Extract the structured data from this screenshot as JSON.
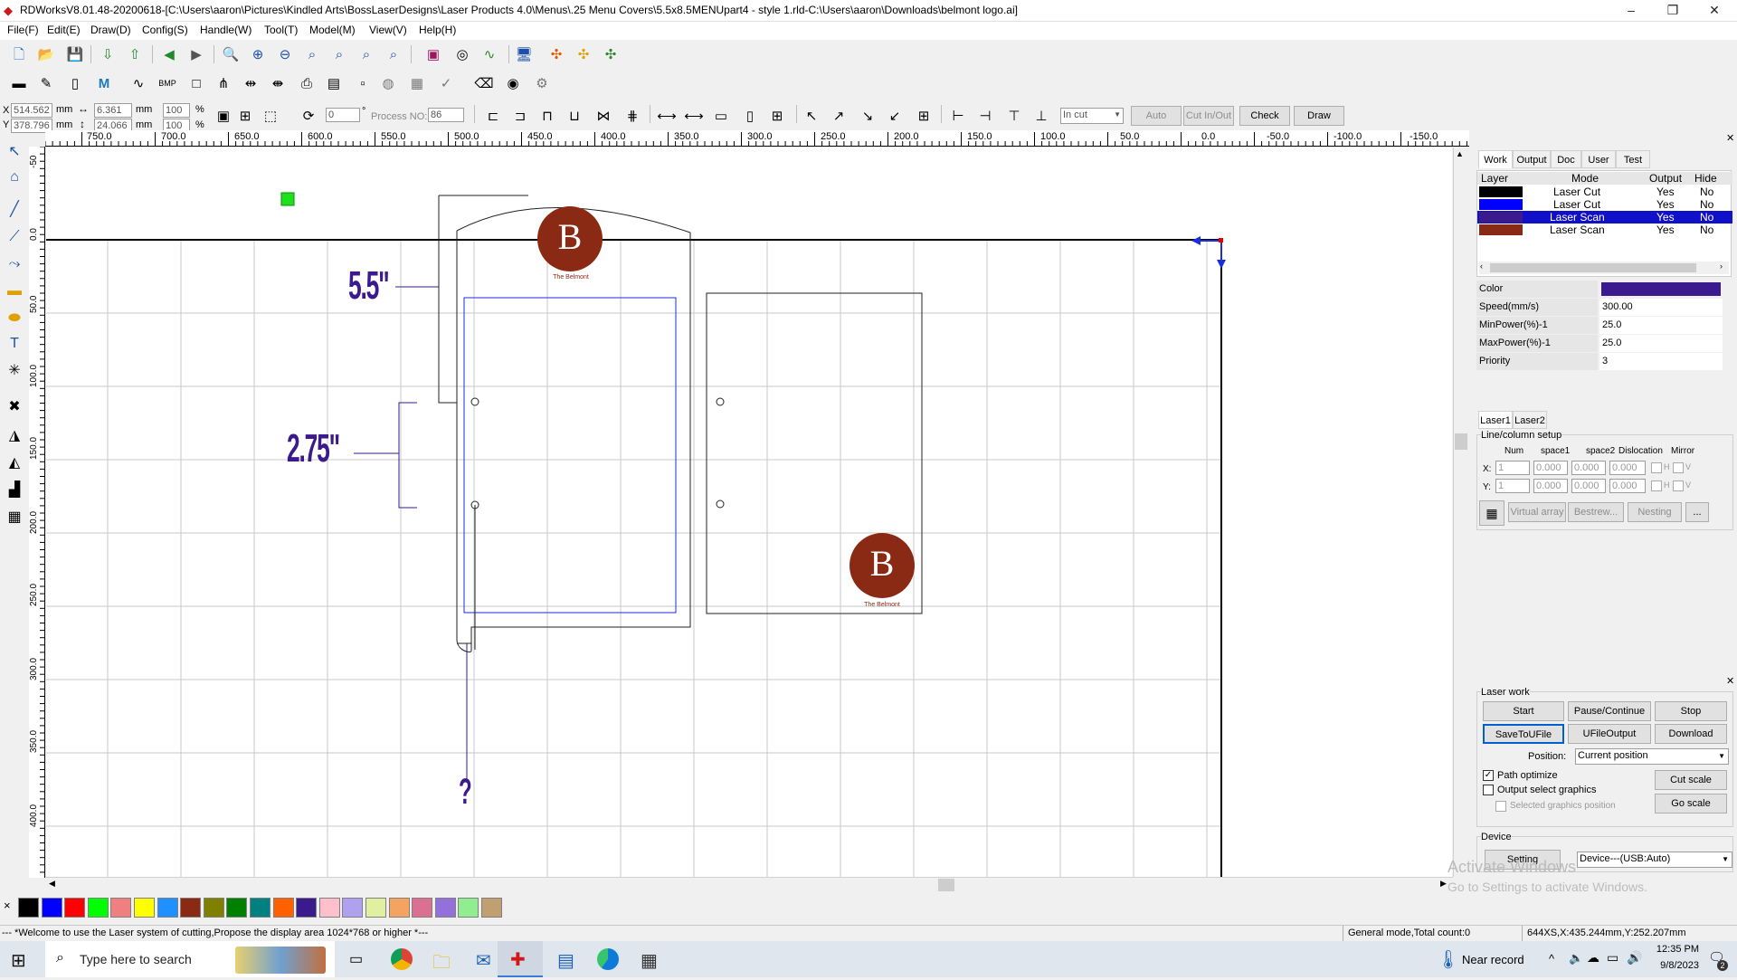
{
  "window": {
    "title": "RDWorksV8.01.48-20200618-[C:\\Users\\aaron\\Pictures\\Kindled Arts\\BossLaserDesigns\\Laser Products 4.0\\Menus\\.25 Menu Covers\\5.5x8.5MENUpart4 - style 1.rld-C:\\Users\\aaron\\Downloads\\belmont logo.ai]",
    "minimize": "–",
    "restore": "❐",
    "close": "✕"
  },
  "menu": [
    "File(F)",
    "Edit(E)",
    "Draw(D)",
    "Config(S)",
    "Handle(W)",
    "Tool(T)",
    "Model(M)",
    "View(V)",
    "Help(H)"
  ],
  "coords": {
    "x_label": "X",
    "x_value": "514.562",
    "y_label": "Y",
    "y_value": "378.796",
    "unit": "mm",
    "w_value": "6.361",
    "h_value": "24.066",
    "sx": "100",
    "sy": "100",
    "pct": "%"
  },
  "toolbar3": {
    "angle": "0",
    "degree": "°",
    "process_no_label": "Process NO:",
    "process_no": "86",
    "cut_mode": "In cut",
    "auto": "Auto",
    "cut_in_out": "Cut In/Out",
    "check": "Check",
    "draw": "Draw"
  },
  "ruler": {
    "h_labels": [
      "750.0",
      "700.0",
      "650.0",
      "600.0",
      "550.0",
      "500.0",
      "450.0",
      "400.0",
      "350.0",
      "300.0",
      "250.0",
      "200.0",
      "150.0",
      "100.0",
      "50.0",
      "0.0",
      "-50.0",
      "-100.0",
      "-150.0"
    ],
    "v_labels": [
      "-50",
      "0.0",
      "50.0",
      "100.0",
      "150.0",
      "200.0",
      "250.0",
      "300.0",
      "350.0",
      "400.0"
    ]
  },
  "canvas": {
    "annotation_1": "5.5\"",
    "annotation_2": "2.75\"",
    "annotation_3": "?",
    "logo_letter": "B",
    "logo_caption": "The Belmont",
    "accent_color": "#3a1a8c",
    "logo_color": "#8b2a14"
  },
  "panel": {
    "tabs": [
      "Work",
      "Output",
      "Doc",
      "User",
      "Test"
    ],
    "layer_headers": [
      "Layer",
      "Mode",
      "Output",
      "Hide"
    ],
    "layers": [
      {
        "color": "#000000",
        "mode": "Laser Cut",
        "output": "Yes",
        "hide": "No"
      },
      {
        "color": "#0000ff",
        "mode": "Laser Cut",
        "output": "Yes",
        "hide": "No"
      },
      {
        "color": "#3a1a8c",
        "mode": "Laser Scan",
        "output": "Yes",
        "hide": "No"
      },
      {
        "color": "#8b2a14",
        "mode": "Laser Scan",
        "output": "Yes",
        "hide": "No"
      }
    ],
    "props": [
      {
        "key": "Color",
        "value": ""
      },
      {
        "key": "Speed(mm/s)",
        "value": "300.00"
      },
      {
        "key": "MinPower(%)-1",
        "value": "25.0"
      },
      {
        "key": "MaxPower(%)-1",
        "value": "25.0"
      },
      {
        "key": "Priority",
        "value": "3"
      }
    ],
    "laser_tabs": [
      "Laser1",
      "Laser2"
    ],
    "array": {
      "title": "Line/column setup",
      "headers": [
        "Num",
        "space1",
        "space2",
        "Dislocation",
        "Mirror"
      ],
      "x_label": "X:",
      "y_label": "Y:",
      "num": "1",
      "zero": "0.000",
      "h": "H",
      "v": "V",
      "virtual_array": "Virtual array",
      "bestrew": "Bestrew...",
      "nesting": "Nesting",
      "more": "..."
    },
    "laser_work": {
      "title": "Laser work",
      "start": "Start",
      "pause": "Pause/Continue",
      "stop": "Stop",
      "save_u": "SaveToUFile",
      "ufile_out": "UFileOutput",
      "download": "Download",
      "position_label": "Position:",
      "position_value": "Current position",
      "path_optimize": "Path optimize",
      "output_select": "Output select graphics",
      "selected_pos": "Selected graphics position",
      "cut_scale": "Cut scale",
      "go_scale": "Go scale"
    },
    "device": {
      "title": "Device",
      "setting": "Setting",
      "device_value": "Device---(USB:Auto)"
    },
    "watermark_1": "Activate Windows",
    "watermark_2": "Go to Settings to activate Windows."
  },
  "palette_colors": [
    "#000000",
    "#0000ff",
    "#ff0000",
    "#00ff00",
    "#f08080",
    "#ffff00",
    "#1e90ff",
    "#8b2a14",
    "#808000",
    "#008000",
    "#008080",
    "#ff6000",
    "#3a1a8c",
    "#ffc0cb",
    "#b0a0f0",
    "#e0f0a0",
    "#f4a460",
    "#db7093",
    "#9370db",
    "#90ee90",
    "#c0a070"
  ],
  "status": {
    "message": "--- *Welcome to use the Laser system of cutting,Propose the display area 1024*768 or higher *---",
    "mode": "General mode,Total count:0",
    "pos": "644XS,X:435.244mm,Y:252.207mm"
  },
  "taskbar": {
    "search_placeholder": "Type here to search",
    "near_record": "Near record",
    "time": "12:35 PM",
    "date": "9/8/2023",
    "notif": "2"
  }
}
